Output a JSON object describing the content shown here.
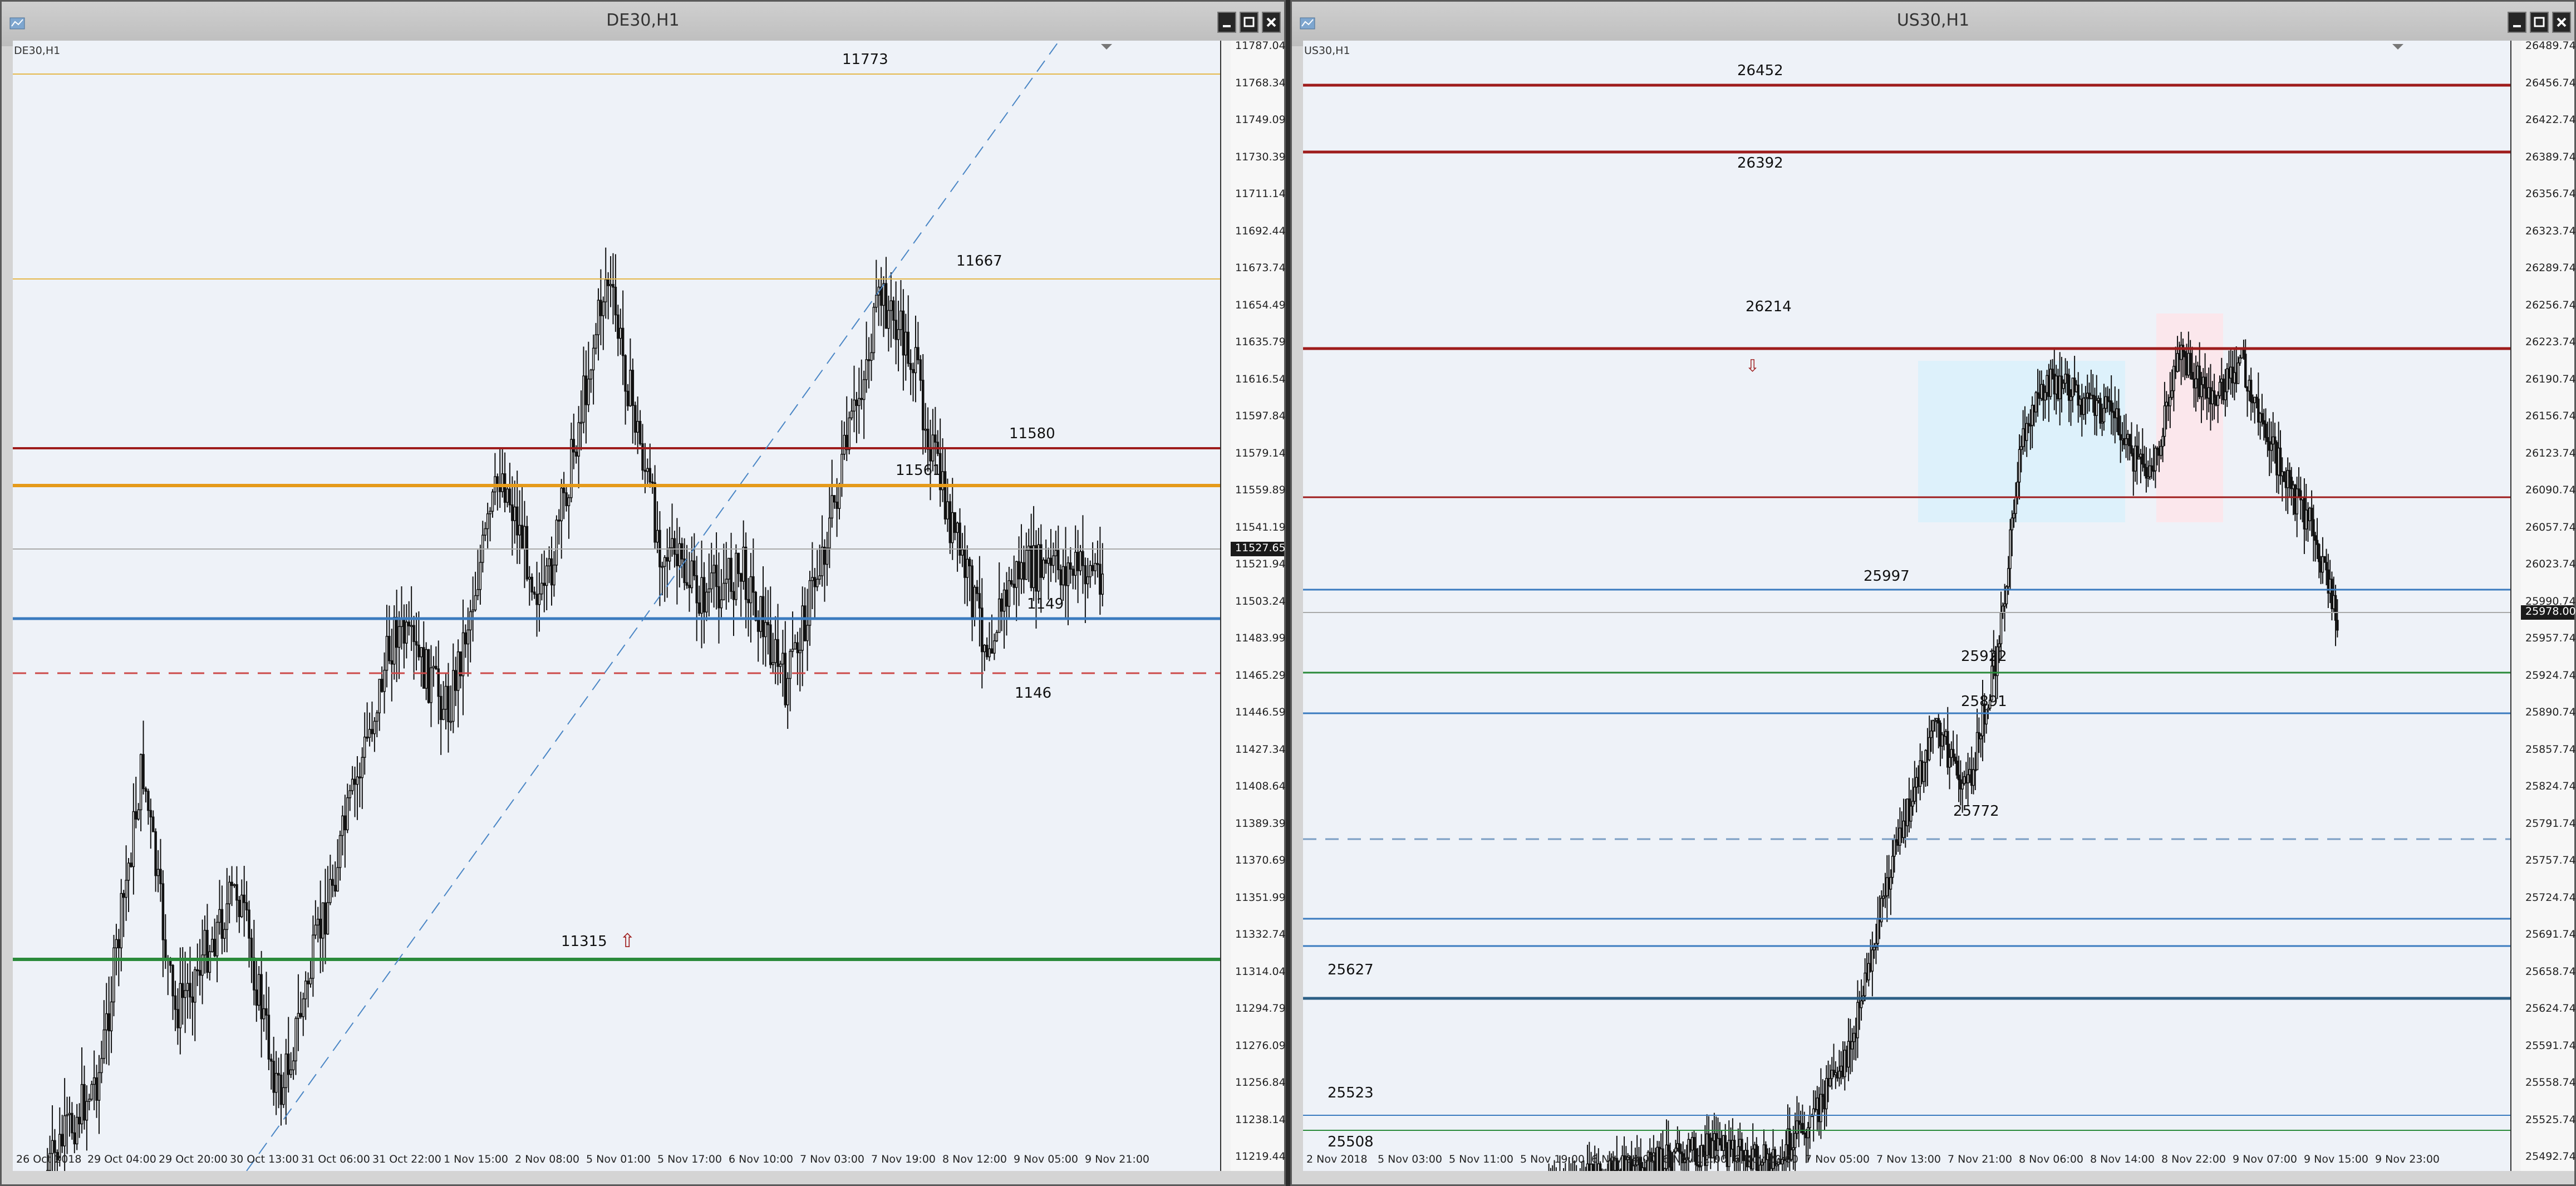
{
  "windows": [
    {
      "title": "DE30,H1",
      "symbol": "DE30,H1",
      "prices": [
        "11787.04",
        "11768.34",
        "11749.09",
        "11730.39",
        "11711.14",
        "11692.44",
        "11673.74",
        "11654.49",
        "11635.79",
        "11616.54",
        "11597.84",
        "11579.14",
        "11559.89",
        "11541.19",
        "11521.94",
        "11503.24",
        "11483.99",
        "11465.29",
        "11446.59",
        "11427.34",
        "11408.64",
        "11389.39",
        "11370.69",
        "11351.99",
        "11332.74",
        "11314.04",
        "11294.79",
        "11276.09",
        "11256.84",
        "11238.14",
        "11219.44"
      ],
      "current_price": "11527.65",
      "times": [
        "26 Oct 2018",
        "29 Oct 04:00",
        "29 Oct 20:00",
        "30 Oct 13:00",
        "31 Oct 06:00",
        "31 Oct 22:00",
        "1 Nov 15:00",
        "2 Nov 08:00",
        "5 Nov 01:00",
        "5 Nov 17:00",
        "6 Nov 10:00",
        "7 Nov 03:00",
        "7 Nov 19:00",
        "8 Nov 12:00",
        "9 Nov 05:00",
        "9 Nov 21:00"
      ],
      "levels": [
        "11773",
        "11667",
        "11580",
        "11561",
        "1149",
        "1146",
        "11315"
      ],
      "arrow": "⇧"
    },
    {
      "title": "US30,H1",
      "symbol": "US30,H1",
      "prices": [
        "26489.74",
        "26456.74",
        "26422.74",
        "26389.74",
        "26356.74",
        "26323.74",
        "26289.74",
        "26256.74",
        "26223.74",
        "26190.74",
        "26156.74",
        "26123.74",
        "26090.74",
        "26057.74",
        "26023.74",
        "25990.74",
        "25957.74",
        "25924.74",
        "25890.74",
        "25857.74",
        "25824.74",
        "25791.74",
        "25757.74",
        "25724.74",
        "25691.74",
        "25658.74",
        "25624.74",
        "25591.74",
        "25558.74",
        "25525.74",
        "25492.74"
      ],
      "current_price": "25978.00",
      "times": [
        "2 Nov 2018",
        "5 Nov 03:00",
        "5 Nov 11:00",
        "5 Nov 19:00",
        "6 Nov 04:00",
        "6 Nov 12:00",
        "6 Nov 20:00",
        "7 Nov 05:00",
        "7 Nov 13:00",
        "7 Nov 21:00",
        "8 Nov 06:00",
        "8 Nov 14:00",
        "8 Nov 22:00",
        "9 Nov 07:00",
        "9 Nov 15:00",
        "9 Nov 23:00"
      ],
      "levels": [
        "26452",
        "26392",
        "26214",
        "25997",
        "25922",
        "25891",
        "25772",
        "25627",
        "25523",
        "25508"
      ],
      "arrow": "⇩"
    }
  ],
  "colors": {
    "red": "#9e1c1c",
    "orange": "#e59a1a",
    "blue": "#3a7bbf",
    "green": "#2a8a3a",
    "candle": "#111111"
  }
}
